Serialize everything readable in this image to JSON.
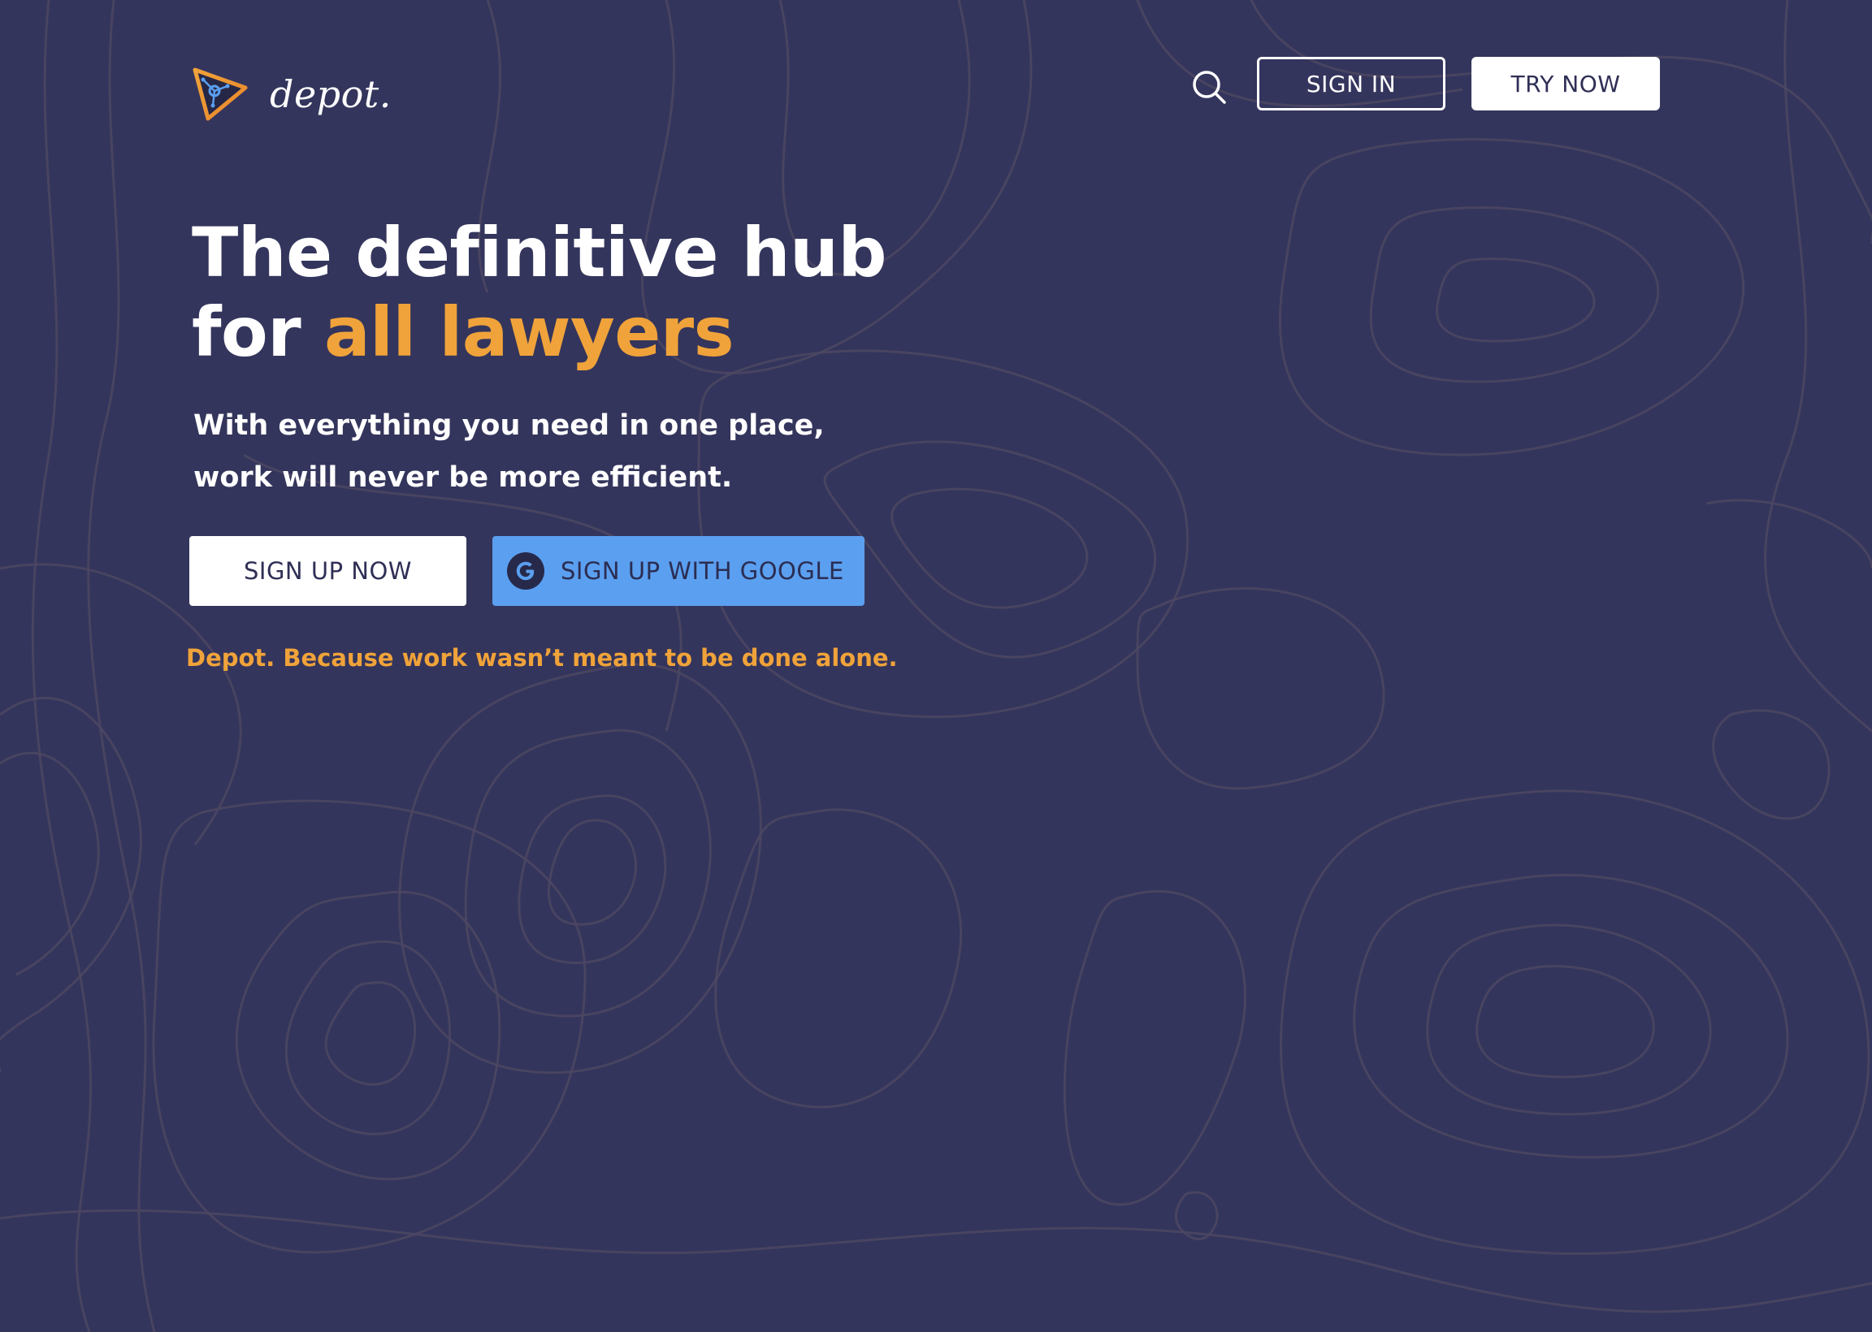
{
  "brand": {
    "name": "depot.",
    "logo_icon": "triangle-network-logo-icon"
  },
  "header": {
    "search_icon": "search-icon",
    "sign_in_label": "SIGN IN",
    "try_now_label": "TRY NOW"
  },
  "hero": {
    "headline_line1": "The definitive hub",
    "headline_line2_prefix": "for ",
    "headline_line2_accent": "all lawyers",
    "subhead_line1": "With everything you need in one place,",
    "subhead_line2": "work will never be more efficient.",
    "signup_label": "SIGN UP NOW",
    "google_signup_label": "SIGN UP WITH GOOGLE",
    "google_icon": "google-g-icon",
    "tagline": "Depot. Because work wasn’t meant to be done alone."
  },
  "colors": {
    "background": "#34355c",
    "accent": "#f0a33a",
    "google_button": "#5b9ff0",
    "topo_lines": "#4c4661",
    "text_light": "#ffffff",
    "text_dark": "#2f2f56"
  }
}
